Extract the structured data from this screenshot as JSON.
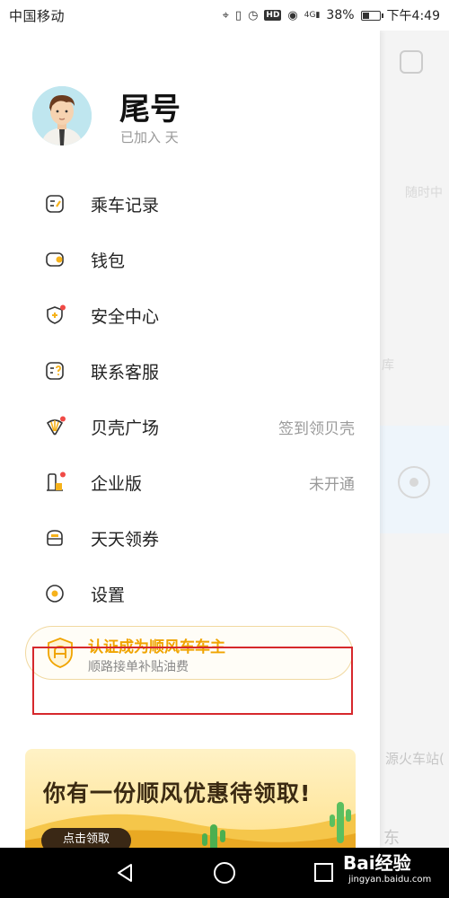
{
  "status_bar": {
    "carrier": "中国移动",
    "network": "4G",
    "battery_percent": "38%",
    "battery_level": 0.38,
    "time": "下午4:49",
    "icons": [
      "location-icon",
      "vibrate-icon",
      "alarm-icon",
      "hd-icon",
      "eye-icon",
      "signal-icon",
      "battery-icon"
    ]
  },
  "profile": {
    "name": "尾号",
    "joined_text": "已加入  天"
  },
  "menu": {
    "items": [
      {
        "label": "乘车记录",
        "icon": "ride-record-icon",
        "extra": ""
      },
      {
        "label": "钱包",
        "icon": "wallet-icon",
        "extra": ""
      },
      {
        "label": "安全中心",
        "icon": "shield-icon",
        "extra": ""
      },
      {
        "label": "联系客服",
        "icon": "customer-service-icon",
        "extra": ""
      },
      {
        "label": "贝壳广场",
        "icon": "shell-icon",
        "extra": "签到领贝壳"
      },
      {
        "label": "企业版",
        "icon": "enterprise-icon",
        "extra": "未开通"
      },
      {
        "label": "天天领券",
        "icon": "coupon-icon",
        "extra": ""
      },
      {
        "label": "设置",
        "icon": "settings-icon",
        "extra": ""
      }
    ]
  },
  "driver_card": {
    "title": "认证成为顺风车车主",
    "subtitle": "顺路接单补贴油费"
  },
  "promo": {
    "title": "你有一份顺风优惠待领取!",
    "button": "点击领取"
  },
  "background_page": {
    "text_1": "随时中",
    "text_2": "库",
    "text_3": "源火车站(",
    "text_4": "东"
  },
  "nav_bar": {
    "watermark": "Bai经验",
    "watermark_sub": "jingyan.baidu.com"
  },
  "colors": {
    "accent": "#f0a400",
    "icon_yellow": "#f6b21b",
    "red_dot": "#f04a46",
    "highlight_red": "#d6282c"
  }
}
